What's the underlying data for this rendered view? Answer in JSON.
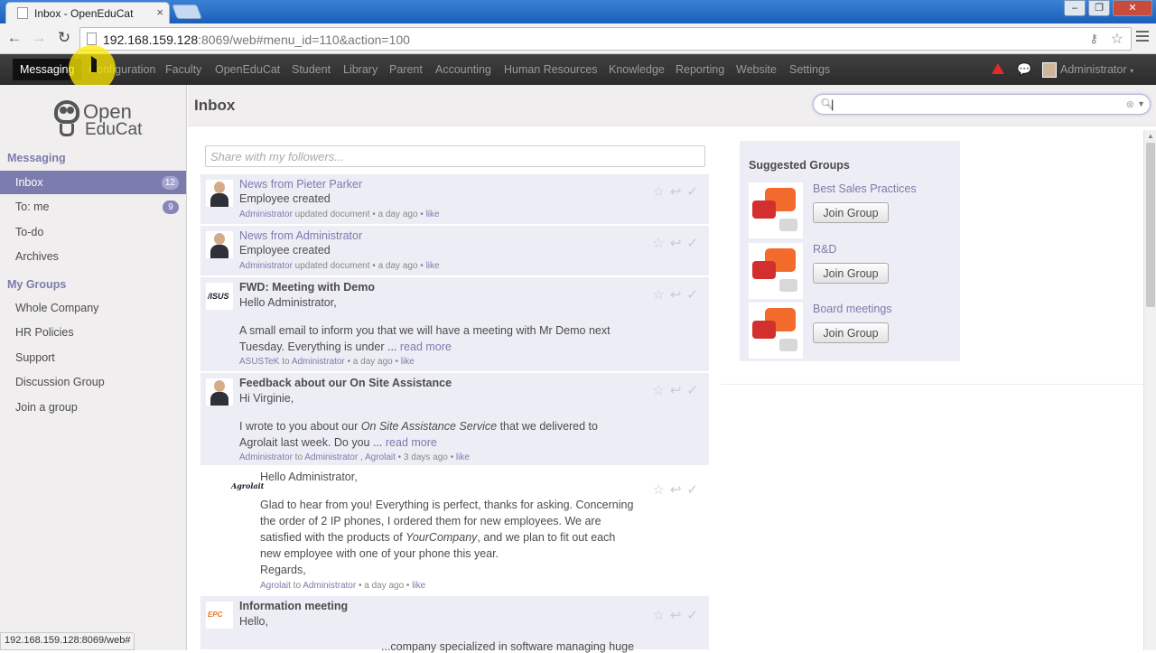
{
  "browser": {
    "tab_title": "Inbox - OpenEduCat",
    "tab_close": "×",
    "url_host": "192.168.159.128",
    "url_rest": ":8069/web#menu_id=110&action=100",
    "status_url": "192.168.159.128:8069/web#"
  },
  "topnav": {
    "items": [
      "Messaging",
      "Configuration",
      "Faculty",
      "OpenEduCat",
      "Student",
      "Library",
      "Parent",
      "Accounting",
      "Human Resources",
      "Knowledge",
      "Reporting",
      "Website",
      "Settings"
    ],
    "user": "Administrator"
  },
  "sidebar": {
    "logo_line1": "Open",
    "logo_line2": "EduCat",
    "section_messaging": "Messaging",
    "inbox_label": "Inbox",
    "inbox_count": "12",
    "tome_label": "To: me",
    "tome_count": "9",
    "todo_label": "To-do",
    "archives_label": "Archives",
    "section_groups": "My Groups",
    "groups": [
      "Whole Company",
      "HR Policies",
      "Support",
      "Discussion Group",
      "Join a group"
    ]
  },
  "main": {
    "title": "Inbox",
    "search_value": "|",
    "share_placeholder": "Share with my followers..."
  },
  "messages": [
    {
      "subject": "News from Pieter Parker",
      "body": "Employee created",
      "author": "Administrator",
      "meta_rest": " updated document • a day ago • ",
      "like": "like"
    },
    {
      "subject": "News from Administrator",
      "body": "Employee created",
      "author": "Administrator",
      "meta_rest": " updated document • a day ago • ",
      "like": "like"
    },
    {
      "subject": "FWD: Meeting with Demo",
      "greeting": "Hello Administrator,",
      "line1": "A small email to inform you that we will have a meeting with Mr Demo next",
      "line2": "Tuesday. Everything is under ...",
      "read_more": "read more",
      "author": "ASUSTeK",
      "to": " to ",
      "recipient": "Administrator",
      "meta_rest": " • a day ago • ",
      "like": "like",
      "avatar_text": "/ISUS"
    },
    {
      "subject": "Feedback about our On Site Assistance",
      "greeting": "Hi Virginie,",
      "line1_a": "I wrote to you about our ",
      "line1_em": "On Site Assistance Service",
      "line1_b": " that we delivered to",
      "line2": "Agrolait last week. Do you ...",
      "read_more": "read more",
      "author": "Administrator",
      "to": " to ",
      "recipient": "Administrator",
      "recipient2": "Agrolait",
      "meta_rest": " • 3 days ago • ",
      "like": "like"
    },
    {
      "greeting": "Hello Administrator,",
      "line1": "Glad to hear from you! Everything is perfect, thanks for asking. Concerning",
      "line2": "the order of 2 IP phones, I ordered them for new employees. We are",
      "line3_a": "satisfied with the products of ",
      "line3_em": "YourCompany",
      "line3_b": ", and we plan to fit out each",
      "line4": "new employee with one of your phone this year.",
      "line5": "Regards,",
      "author": "Agrolait",
      "to": " to ",
      "recipient": "Administrator",
      "meta_rest": " • a day ago • ",
      "like": "like",
      "avatar_text": "Agrolait"
    },
    {
      "subject": "Information meeting",
      "greeting": "Hello,",
      "line1": "...company specialized in software managing huge",
      "avatar_text": "EPC"
    }
  ],
  "suggested": {
    "title": "Suggested Groups",
    "join_label": "Join Group",
    "groups": [
      "Best Sales Practices",
      "R&D",
      "Board meetings"
    ]
  },
  "icons": {
    "star": "☆",
    "reply": "↩",
    "check": "✓",
    "search": "⚲",
    "clear": "⊗",
    "chat": "💬"
  },
  "colors": {
    "accent": "#7c7bad",
    "topnav": "#333333",
    "alert": "#e02b2b"
  }
}
